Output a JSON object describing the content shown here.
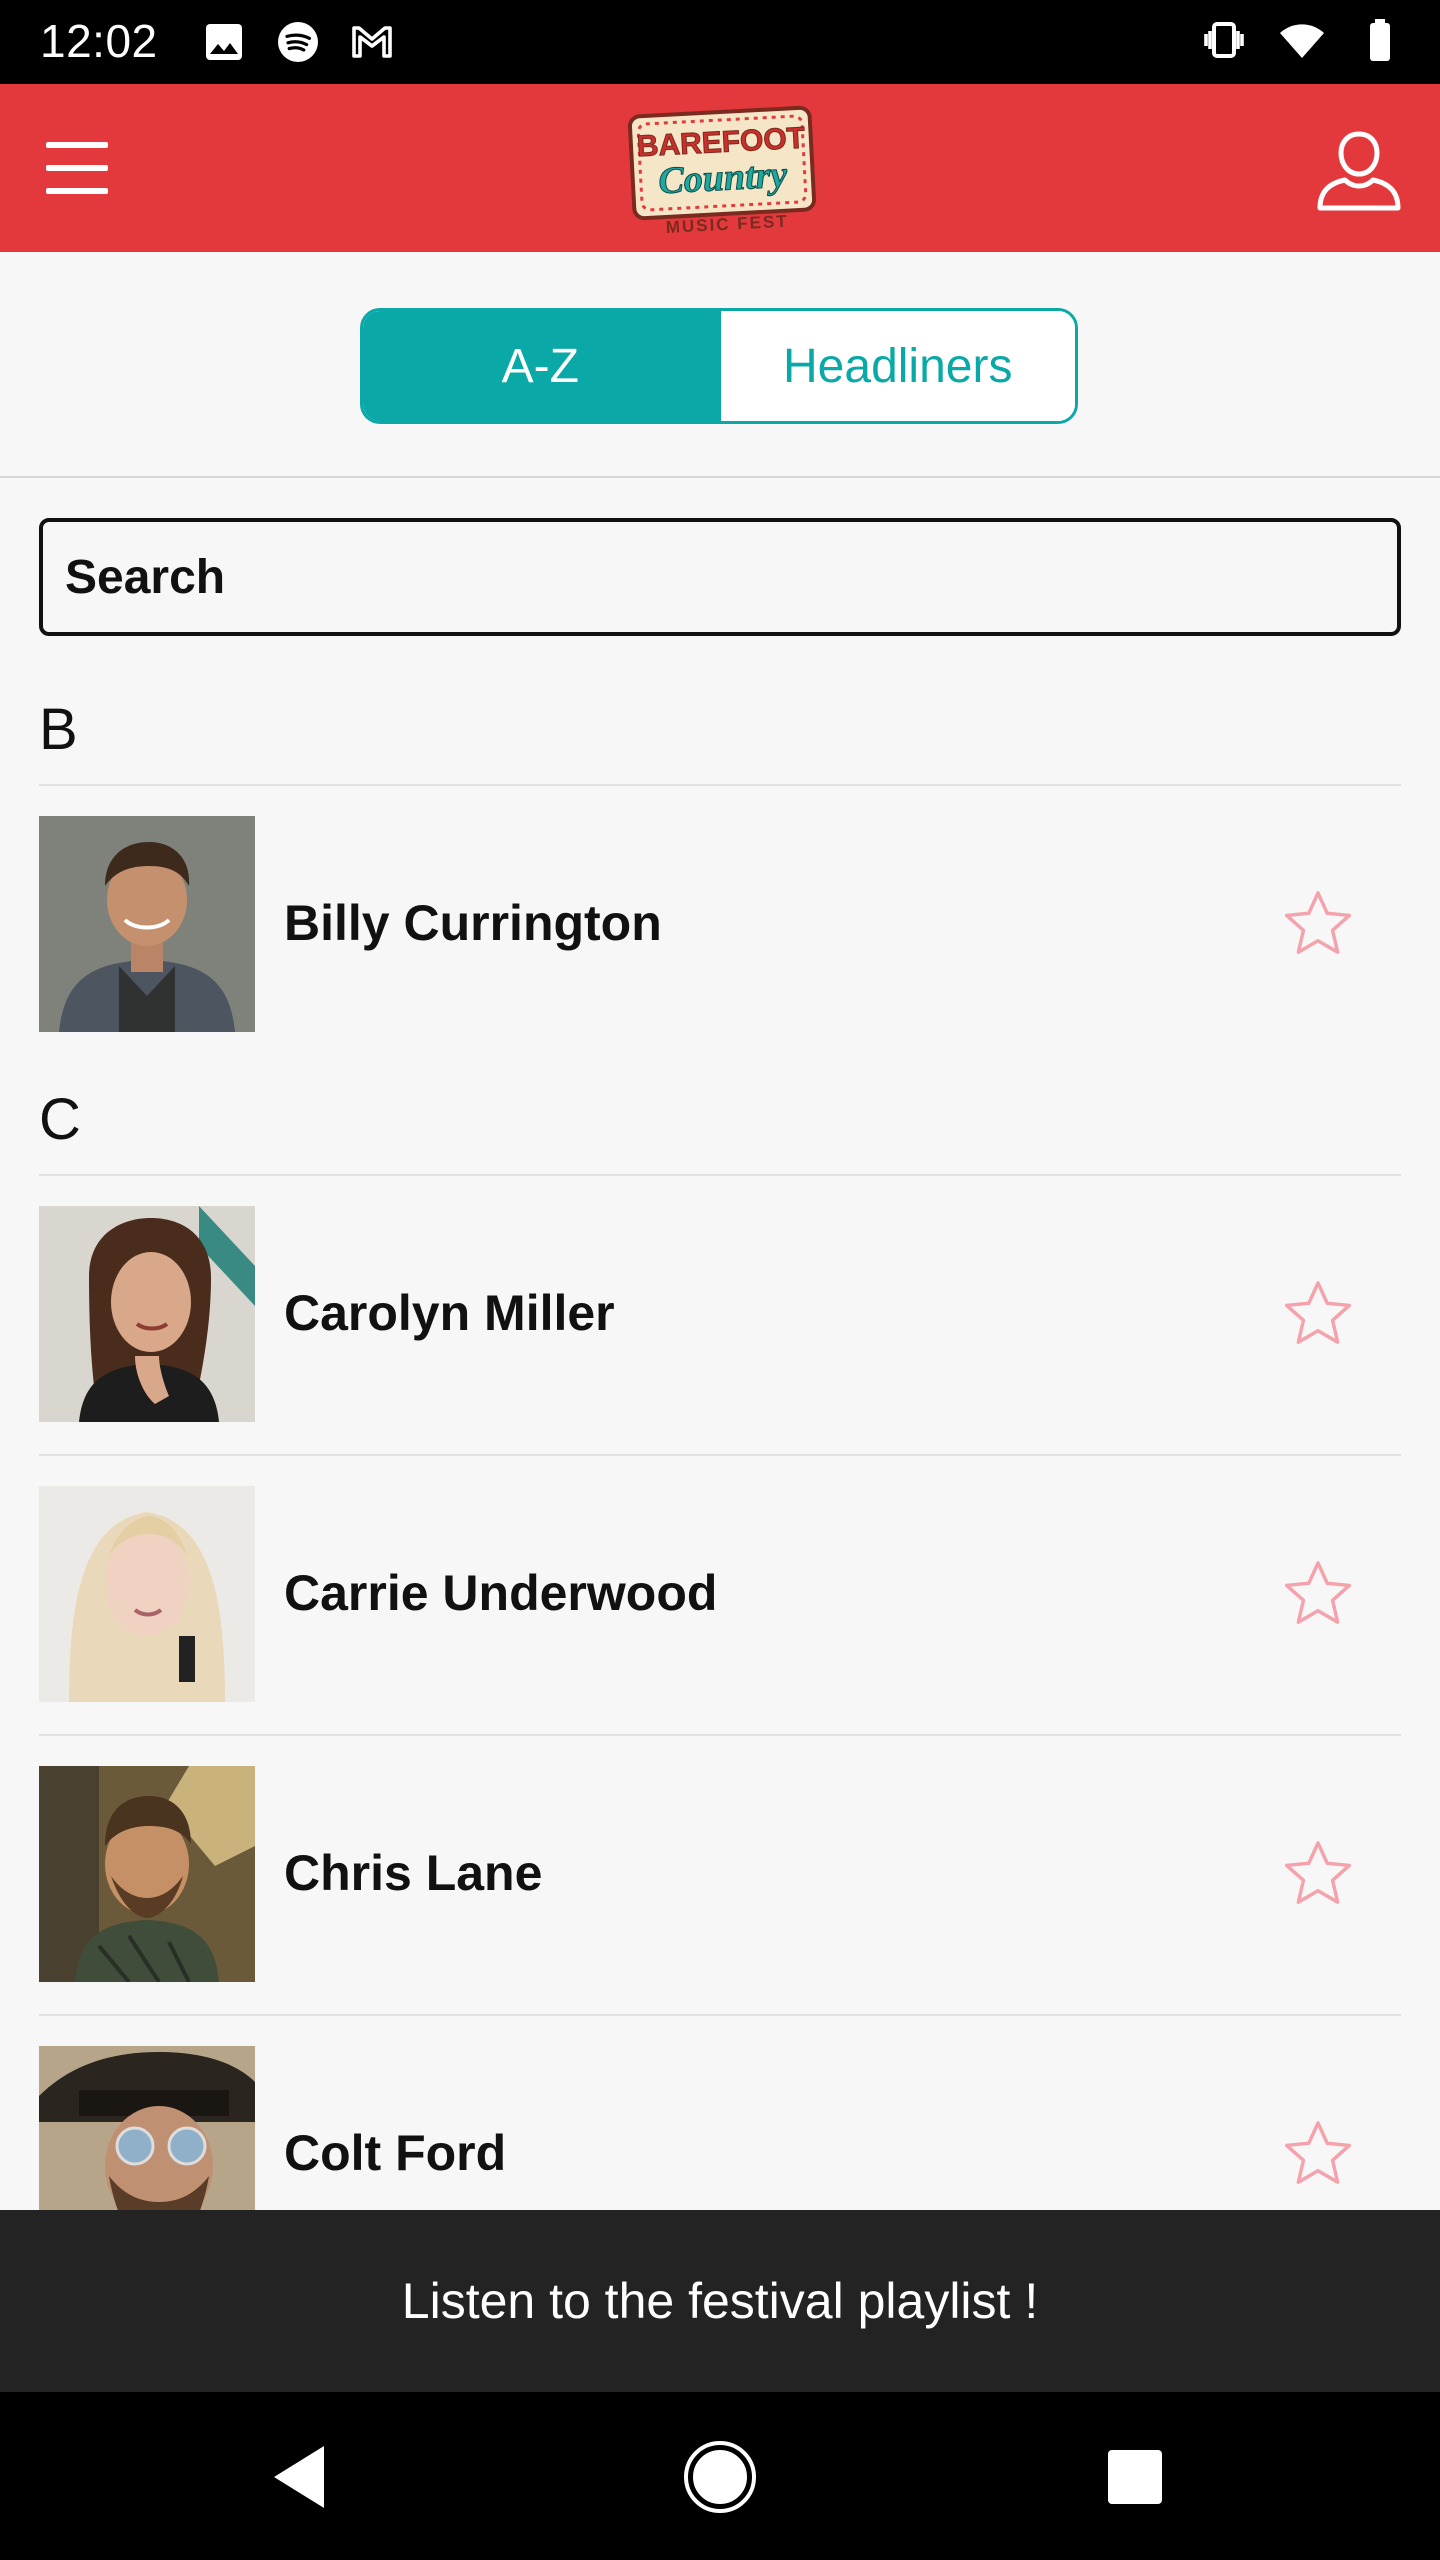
{
  "status_bar": {
    "time": "12:02",
    "left_icons": [
      "image-icon",
      "spotify-icon",
      "gmail-icon"
    ],
    "right_icons": [
      "vibrate-icon",
      "wifi-icon",
      "battery-icon"
    ]
  },
  "header": {
    "background_color": "#e4393c",
    "logo": {
      "line1": "BAREFOOT",
      "line2": "Country",
      "line3": "MUSIC FEST"
    }
  },
  "tabs": [
    {
      "label": "A-Z",
      "active": true
    },
    {
      "label": "Headliners",
      "active": false
    }
  ],
  "accent_color": "#0aa9a8",
  "search": {
    "placeholder": "Search",
    "value": ""
  },
  "sections": [
    {
      "letter": "B",
      "artists": [
        {
          "name": "Billy Currington",
          "favorite": false
        }
      ]
    },
    {
      "letter": "C",
      "artists": [
        {
          "name": "Carolyn Miller",
          "favorite": false
        },
        {
          "name": "Carrie Underwood",
          "favorite": false
        },
        {
          "name": "Chris Lane",
          "favorite": false
        },
        {
          "name": "Colt Ford",
          "favorite": false
        }
      ]
    }
  ],
  "star_color": "#f4a3ad",
  "playlist_banner": {
    "text": "Listen to the festival playlist !"
  },
  "nav": [
    "back-icon",
    "home-icon",
    "recents-icon"
  ]
}
